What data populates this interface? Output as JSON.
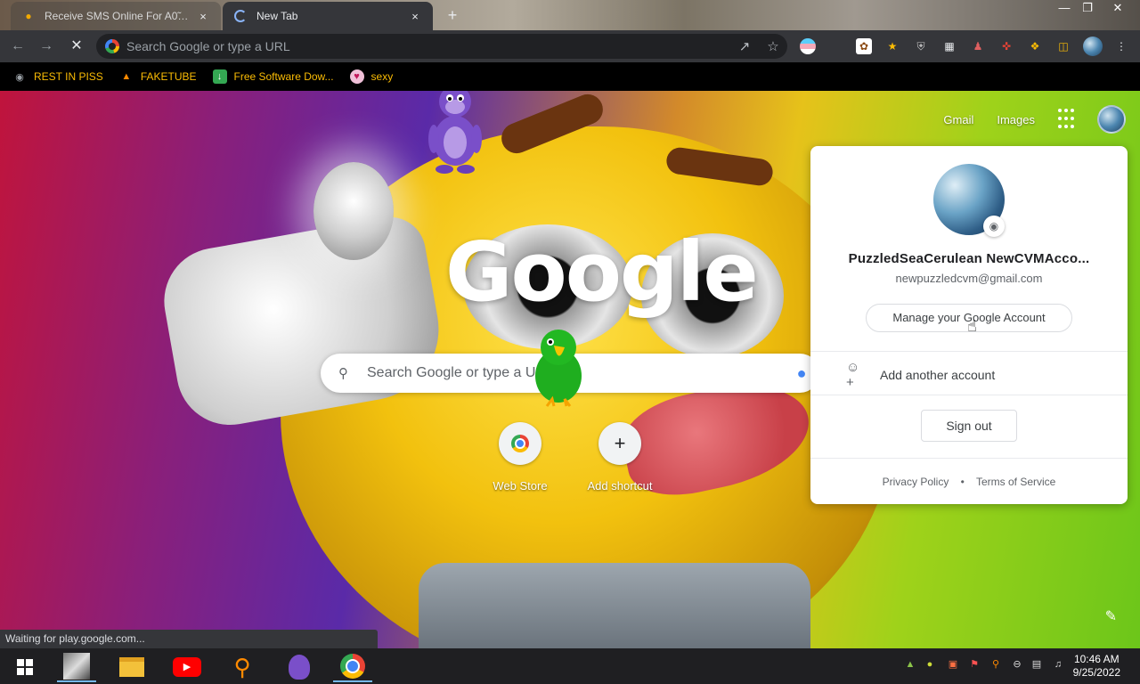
{
  "tabs": [
    {
      "title": "Receive SMS Online For A0̃%12-",
      "favicon": "sms-favicon",
      "close": "×"
    },
    {
      "title": "New Tab",
      "favicon": "loading-spinner",
      "close": "×"
    }
  ],
  "newtab_label": "+",
  "window_controls": {
    "minimize": "—",
    "maximize": "❐",
    "close": "✕"
  },
  "omnibox": {
    "placeholder": "Search Google or type a URL",
    "value": ""
  },
  "bookmarks": [
    {
      "label": "REST IN PISS",
      "icon": "globe-icon",
      "icon_color": "#9aa0a6"
    },
    {
      "label": "FAKETUBE",
      "icon": "fire-icon",
      "icon_color": "#ff8a00"
    },
    {
      "label": "Free Software Dow...",
      "icon": "download-icon",
      "icon_color": "#34a853"
    },
    {
      "label": "sexy",
      "icon": "heart-icon",
      "icon_color": "#f0c0d8"
    }
  ],
  "ntp": {
    "top_links": {
      "gmail": "Gmail",
      "images": "Images"
    },
    "logo": "Google",
    "search_placeholder": "Search Google or type a URL",
    "shortcuts": [
      {
        "label": "Web Store",
        "icon": "chrome-webstore-icon"
      },
      {
        "label": "Add shortcut",
        "icon": "plus-icon",
        "glyph": "+"
      }
    ]
  },
  "account_popup": {
    "name": "PuzzledSeaCerulean NewCVMAcco...",
    "email": "newpuzzledcvm@gmail.com",
    "manage_label": "Manage your Google Account",
    "add_account_label": "Add another account",
    "sign_out_label": "Sign out",
    "privacy_label": "Privacy Policy",
    "separator": "•",
    "terms_label": "Terms of Service"
  },
  "status_text": "Waiting for play.google.com...",
  "taskbar": {
    "apps": [
      "start-button",
      "app-thumbnail",
      "file-explorer",
      "youtube",
      "search-tool",
      "bonzi",
      "chrome"
    ],
    "time": "10:46 AM",
    "date": "9/25/2022"
  },
  "colors": {
    "bookmark_text": "#fbbc04",
    "toolbar_bg": "#35363a",
    "taskbar_bg": "#1f1f22",
    "accent": "#4285f4"
  }
}
